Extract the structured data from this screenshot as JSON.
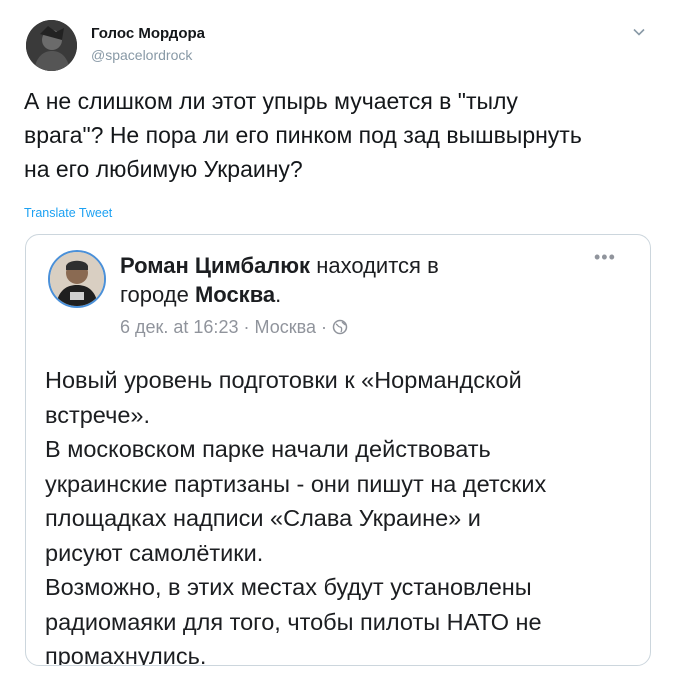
{
  "author": {
    "name": "Голос Мордора",
    "handle": "@spacelordrock"
  },
  "tweet": {
    "line1": "А не слишком ли этот упырь мучается в \"тылу",
    "line2": "врага\"? Не пора ли его пинком под зад вышвырнуть",
    "line3": "на его любимую Украину?",
    "translate_label": "Translate Tweet"
  },
  "embedded_post": {
    "author_name": "Роман Цимбалюк",
    "status_prefix": "находится в",
    "status_mid": "городе",
    "city": "Москва",
    "status_end": ".",
    "date": "6 дек. at 16:23",
    "meta_sep": "·",
    "location": "Москва",
    "more_label": "•••",
    "body": [
      "Новый уровень подготовки к «Нормандской",
      "встрече».",
      "В московском парке начали действовать",
      "украинские партизаны - они пишут на детских",
      "площадках надписи «Слава Украине» и",
      "рисуют самолётики.",
      "Возможно, в этих местах будут установлены",
      "радиомаяки для того, чтобы пилоты НАТО не",
      "промахнулись."
    ]
  },
  "icons": {
    "caret": "chevron-down-icon",
    "globe": "globe-icon"
  },
  "colors": {
    "link": "#1da1f2",
    "muted": "#8899a6",
    "fb_border": "#4a90d9"
  }
}
